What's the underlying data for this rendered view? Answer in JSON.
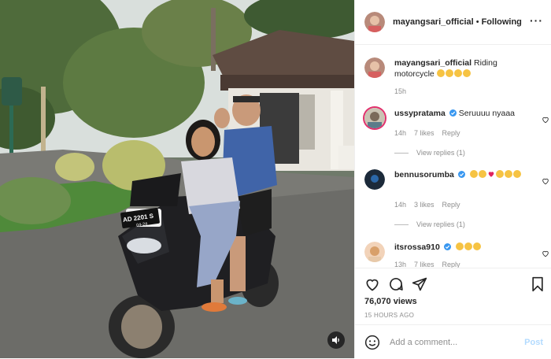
{
  "post": {
    "username": "mayangsari_official",
    "follow_separator": "•",
    "follow_label": "Following",
    "more_icon": "ellipsis-icon",
    "caption": {
      "username": "mayangsari_official",
      "text": "Riding motorcycle",
      "emojis": [
        "heart-eyes-emoji",
        "smile-emoji",
        "smile-emoji",
        "heart-eyes-emoji"
      ],
      "time": "15h"
    },
    "comments": [
      {
        "username": "ussypratama",
        "verified": true,
        "text": "Seruuuu nyaaa",
        "emojis": [],
        "time": "14h",
        "likes": "7 likes",
        "reply": "Reply",
        "view_replies": "View replies (1)"
      },
      {
        "username": "bennusorumba",
        "verified": true,
        "text": "",
        "emojis": [
          "laugh-emoji",
          "laugh-emoji",
          "red-heart-emoji",
          "heart-eyes-emoji",
          "heart-eyes-emoji",
          "heart-eyes-emoji"
        ],
        "time": "14h",
        "likes": "3 likes",
        "reply": "Reply",
        "view_replies": "View replies (1)"
      },
      {
        "username": "itsrossa910",
        "verified": true,
        "text": "",
        "emojis": [
          "laugh-emoji",
          "laugh-emoji",
          "laugh-emoji"
        ],
        "time": "13h",
        "likes": "7 likes",
        "reply": "Reply"
      }
    ],
    "views": "76,070 views",
    "timestamp": "15 HOURS AGO",
    "comment_placeholder": "Add a comment...",
    "post_label": "Post",
    "media": {
      "plate_line1": "AD 2201 S",
      "plate_line2": "04-24",
      "sound_icon": "speaker-icon"
    },
    "colors": {
      "text": "#262626",
      "muted": "#8e8e8e",
      "border": "#efefef",
      "post_button": "#b3dbff",
      "verified": "#3897f0"
    }
  }
}
